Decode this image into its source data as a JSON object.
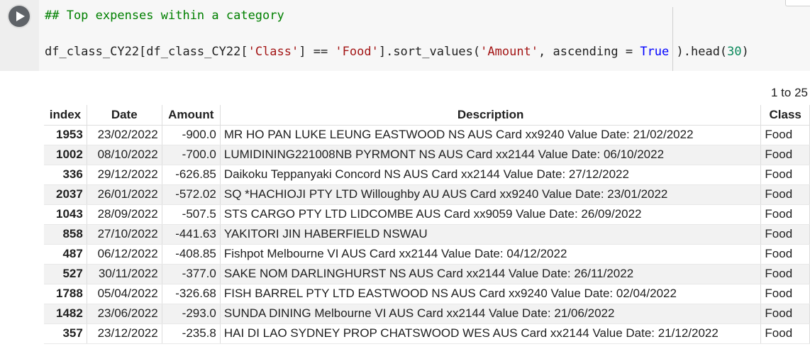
{
  "code": {
    "comment": "## Top expenses within a category",
    "line": {
      "p1": "df_class_CY22[df_class_CY22[",
      "s1": "'Class'",
      "p2": "] == ",
      "s2": "'Food'",
      "p3": "].sort_values(",
      "s3": "'Amount'",
      "p4": ", ascending = ",
      "k1": "True",
      "p5": " ).head(",
      "n1": "30",
      "p6": ")"
    }
  },
  "output": {
    "pagination": "1 to 25",
    "columns": [
      "index",
      "Date",
      "Amount",
      "Description",
      "Class"
    ],
    "rows": [
      [
        "1953",
        "23/02/2022",
        "-900.0",
        "MR HO PAN LUKE LEUNG EASTWOOD NS AUS Card xx9240 Value Date: 21/02/2022",
        "Food"
      ],
      [
        "1002",
        "08/10/2022",
        "-700.0",
        "LUMIDINING221008NB PYRMONT NS AUS Card xx2144 Value Date: 06/10/2022",
        "Food"
      ],
      [
        "336",
        "29/12/2022",
        "-626.85",
        "Daikoku Teppanyaki Concord NS AUS Card xx2144 Value Date: 27/12/2022",
        "Food"
      ],
      [
        "2037",
        "26/01/2022",
        "-572.02",
        "SQ *HACHIOJI PTY LTD Willoughby AU AUS Card xx9240 Value Date: 23/01/2022",
        "Food"
      ],
      [
        "1043",
        "28/09/2022",
        "-507.5",
        "STS CARGO PTY LTD LIDCOMBE AUS Card xx9059 Value Date: 26/09/2022",
        "Food"
      ],
      [
        "858",
        "27/10/2022",
        "-441.63",
        "YAKITORI JIN HABERFIELD NSWAU",
        "Food"
      ],
      [
        "487",
        "06/12/2022",
        "-408.85",
        "Fishpot Melbourne VI AUS Card xx2144 Value Date: 04/12/2022",
        "Food"
      ],
      [
        "527",
        "30/11/2022",
        "-377.0",
        "SAKE NOM DARLINGHURST NS AUS Card xx2144 Value Date: 26/11/2022",
        "Food"
      ],
      [
        "1788",
        "05/04/2022",
        "-326.68",
        "FISH BARREL PTY LTD EASTWOOD NS AUS Card xx9240 Value Date: 02/04/2022",
        "Food"
      ],
      [
        "1482",
        "23/06/2022",
        "-293.0",
        "SUNDA DINING Melbourne VI AUS Card xx2144 Value Date: 21/06/2022",
        "Food"
      ],
      [
        "357",
        "23/12/2022",
        "-235.8",
        "HAI DI LAO SYDNEY PROP CHATSWOOD WES AUS Card xx2144 Value Date: 21/12/2022",
        "Food"
      ]
    ]
  },
  "colors": {
    "run_button": "#5f6368",
    "comment": "#008000",
    "string": "#a31515",
    "keyword": "#0000ff",
    "number": "#09885a"
  },
  "icons": {
    "run": "play-icon"
  }
}
